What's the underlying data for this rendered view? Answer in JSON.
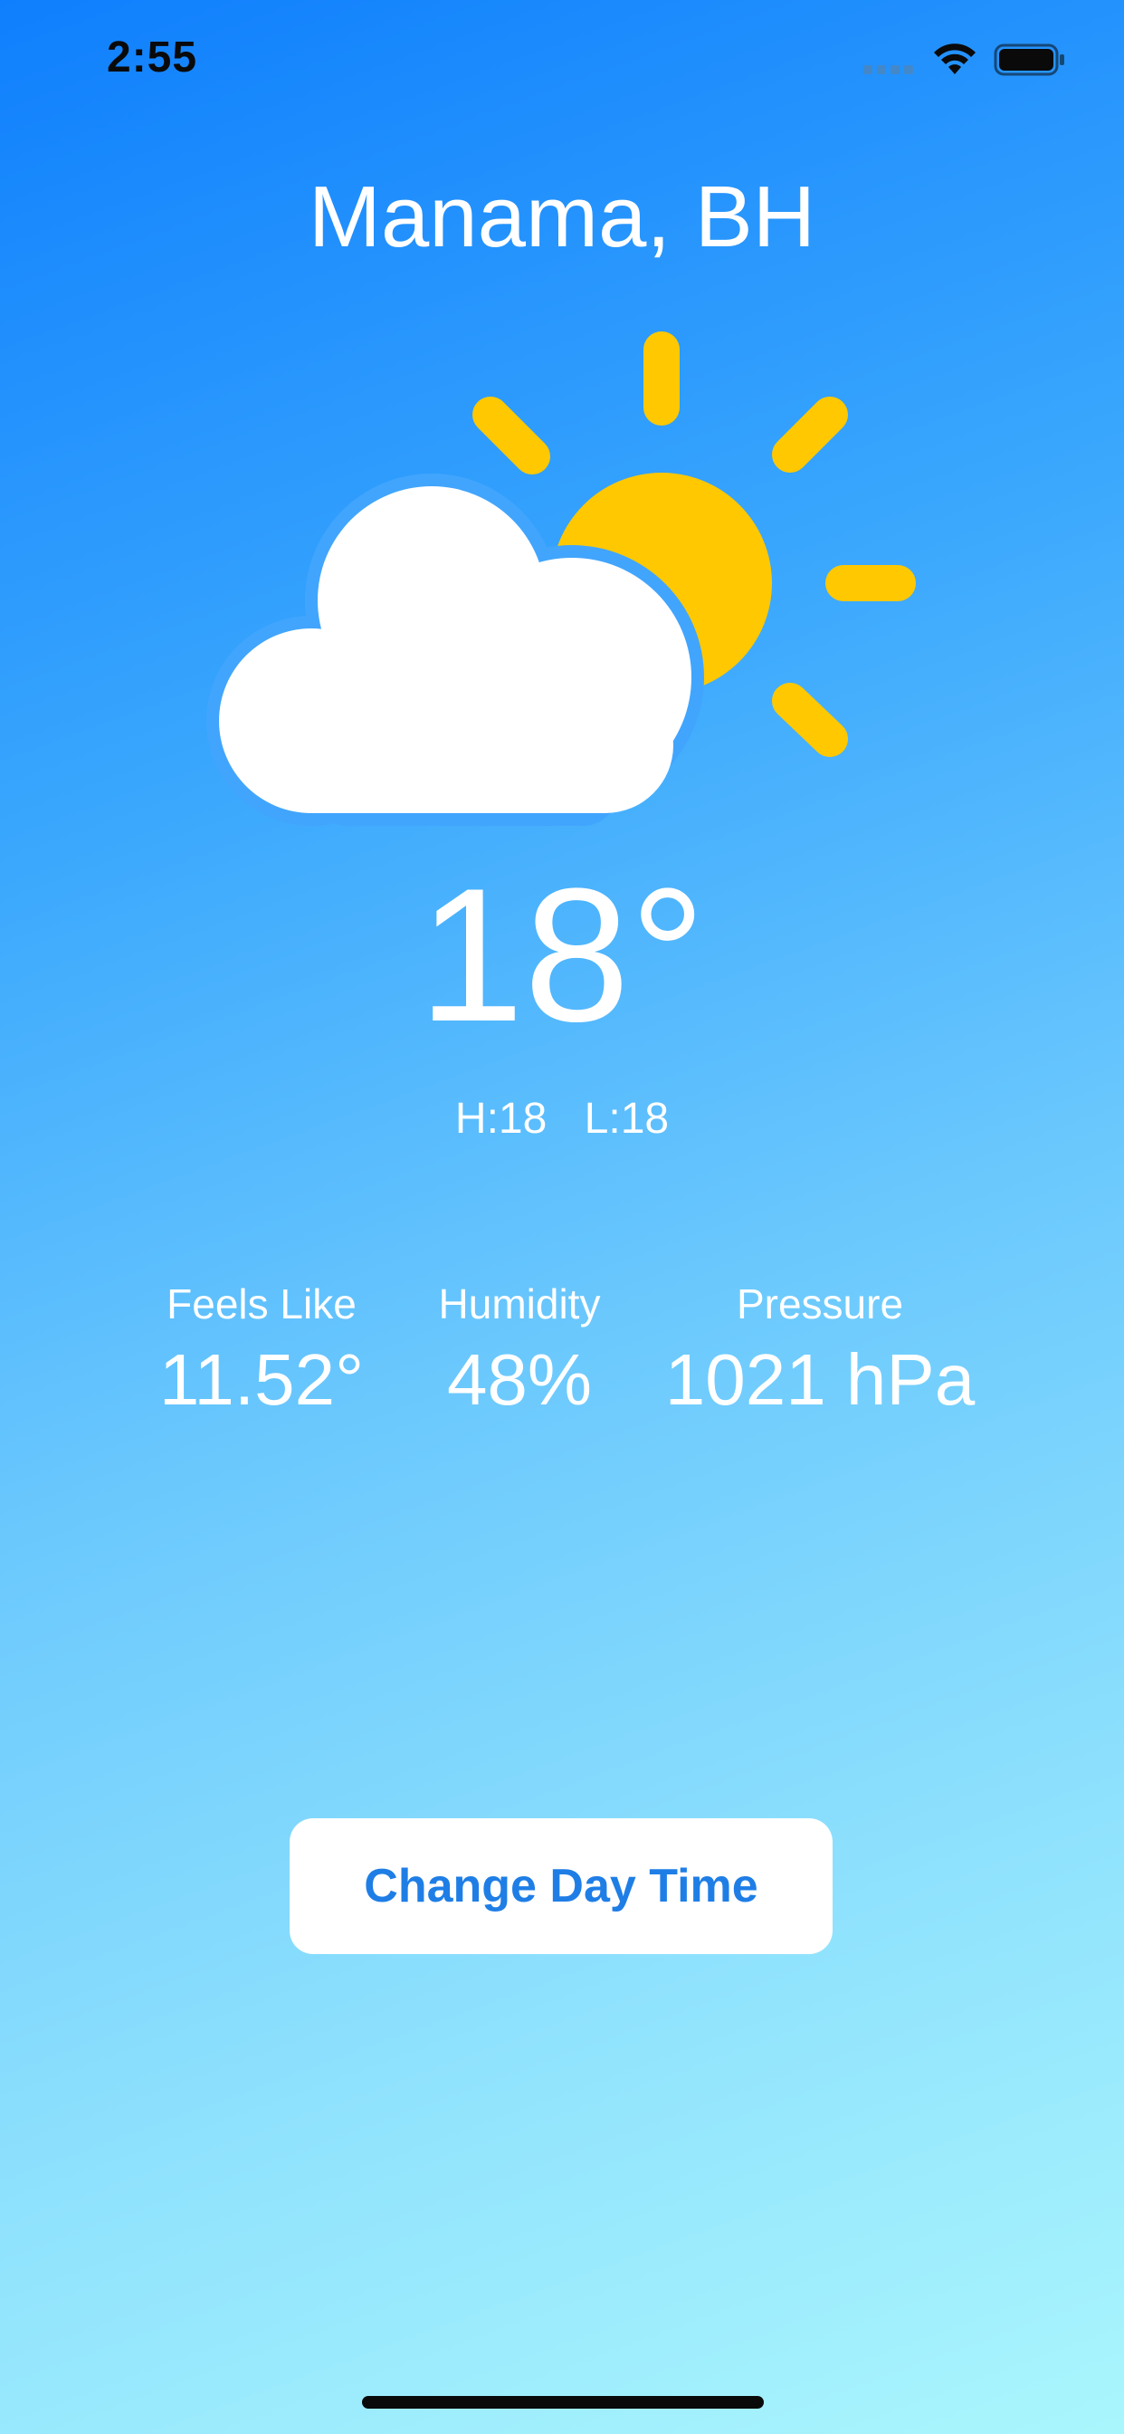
{
  "status_bar": {
    "time": "2:55",
    "icons": [
      "signal-icon",
      "wifi-icon",
      "battery-icon"
    ]
  },
  "location": {
    "city": "Manama, BH"
  },
  "condition_icon": "partly-sunny-icon",
  "current": {
    "temperature": "18°",
    "high": "H:18",
    "low": "L:18"
  },
  "stats": {
    "feels_like": {
      "label": "Feels Like",
      "value": "11.52°"
    },
    "humidity": {
      "label": "Humidity",
      "value": "48%"
    },
    "pressure": {
      "label": "Pressure",
      "value": "1021 hPa"
    }
  },
  "actions": {
    "change_day_time_label": "Change Day Time"
  },
  "colors": {
    "background_top": "#0f7ffd",
    "background_bottom": "#aaf6fd",
    "sun": "#ffc800",
    "button_text": "#1f7ee6"
  }
}
